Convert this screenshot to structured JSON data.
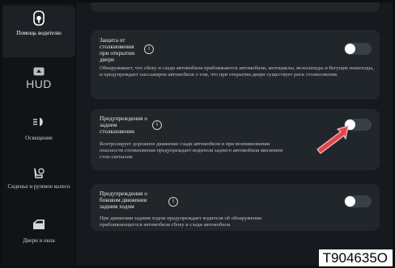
{
  "sidebar": {
    "items": [
      {
        "label": "Помощь водителю",
        "icon": "steering-wheel-icon",
        "active": true
      },
      {
        "label": "HUD",
        "icon": "hud-icon",
        "active": false
      },
      {
        "label": "Освещение",
        "icon": "headlight-icon",
        "active": false
      },
      {
        "label": "Сиденье и рулевое колесо",
        "icon": "seat-icon",
        "active": false
      },
      {
        "label": "Двери и окна",
        "icon": "door-icon",
        "active": false
      }
    ]
  },
  "cards": [
    {
      "title": "Защита от столкновения при открытии двери",
      "description": "Обнаруживает, что сбоку и сзади автомобиля приближаются автомобили, мотоциклы, велосипеды и бегущие пешеходы, и предупреждает пассажиров автомобиля о том, что при открытии двери существует риск столкновения.",
      "toggle_on": false
    },
    {
      "title": "Предупреждения о заднем столкновении",
      "description": "Контролирует дорожное движение сзади автомобиля и при возникновении опасности столкновения предупреждает водителя заднего автомобиля миганием стоп-сигналов.",
      "toggle_on": false
    },
    {
      "title": "Предупреждения о боковом движении задним ходом",
      "description": "При движении задним ходом предупреждает водителя об обнаружении приближающегося автомобиля сбоку и сзади автомобиля",
      "toggle_on": false
    }
  ],
  "info_glyph": "i",
  "reference_code": "T904635O",
  "colors": {
    "annotation_arrow": "#e0454e",
    "card_bg": "#21262b",
    "toggle_track": "#3a4048"
  }
}
